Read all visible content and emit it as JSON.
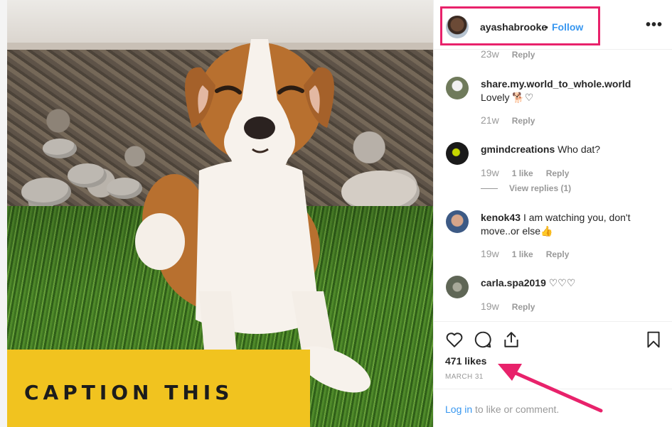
{
  "post": {
    "caption_overlay": "CAPTION THIS"
  },
  "header": {
    "username": "ayashabrooke",
    "separator": "•",
    "follow_label": "Follow",
    "more_label": "•••"
  },
  "comments": [
    {
      "age": "23w",
      "reply": "Reply"
    },
    {
      "user": "share.my.world_to_whole.world",
      "text": "Lovely 🐕♡",
      "age": "21w",
      "reply": "Reply"
    },
    {
      "user": "gmindcreations",
      "text": "Who dat?",
      "age": "19w",
      "likes": "1 like",
      "reply": "Reply",
      "view_replies": "View replies (1)"
    },
    {
      "user": "kenok43",
      "text": "I am watching you, don't move..or else👍",
      "age": "19w",
      "likes": "1 like",
      "reply": "Reply"
    },
    {
      "user": "carla.spa2019",
      "text": "♡♡♡",
      "age": "19w",
      "reply": "Reply"
    }
  ],
  "actions": {
    "likes_label": "471 likes",
    "date": "MARCH 31"
  },
  "login": {
    "link": "Log in",
    "rest": " to like or comment."
  },
  "icons": [
    "heart-icon",
    "comment-icon",
    "share-icon",
    "bookmark-icon",
    "more-options-icon"
  ],
  "colors": {
    "link_blue": "#3897f0",
    "annotation_pink": "#e8226b",
    "caption_yellow": "#f1c31f"
  }
}
